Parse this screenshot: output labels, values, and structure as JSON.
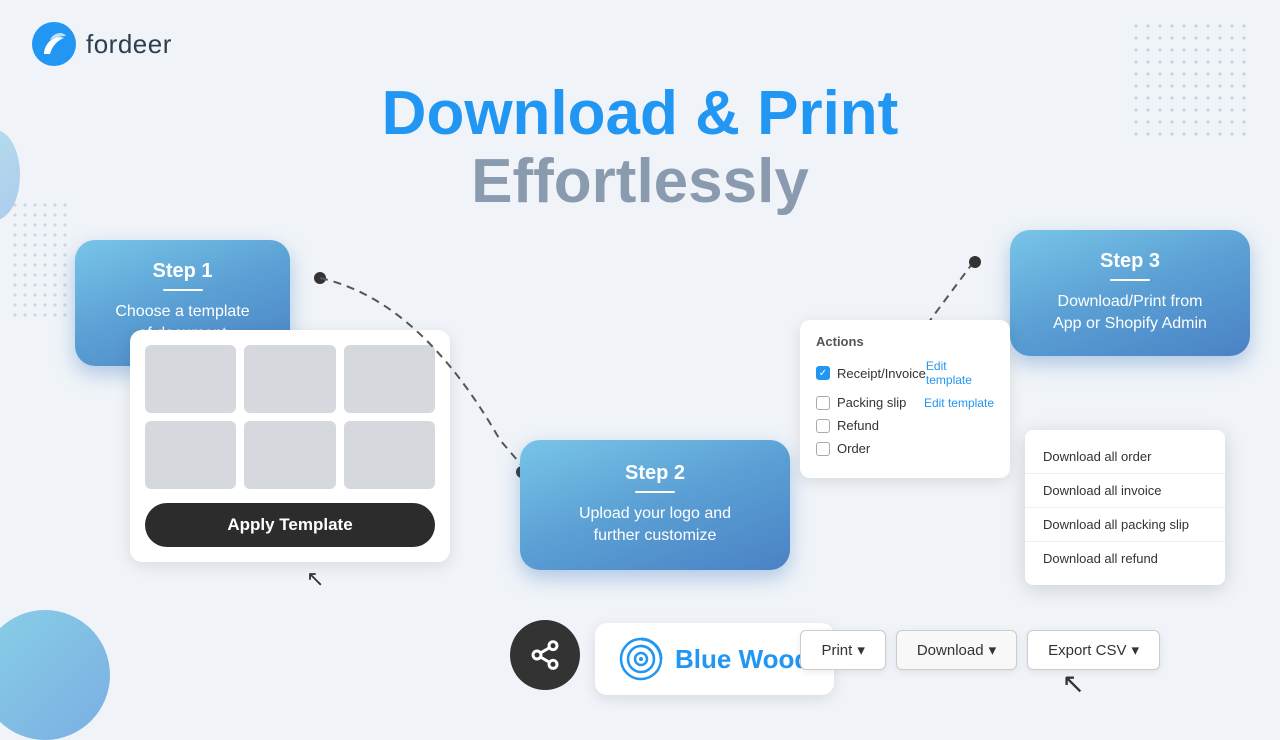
{
  "brand": {
    "logo_alt": "Fordeer logo",
    "name": "fordeer"
  },
  "hero": {
    "line1": "Download & Print",
    "line2": "Effortlessly"
  },
  "step1": {
    "label": "Step 1",
    "description": "Choose a template\nof document",
    "apply_button": "Apply Template"
  },
  "step2": {
    "label": "Step 2",
    "description": "Upload your logo and\nfurther customize"
  },
  "step3": {
    "label": "Step 3",
    "description": "Download/Print from\nApp or Shopify Admin"
  },
  "actions_card": {
    "title": "Actions",
    "items": [
      {
        "name": "Receipt/Invoice",
        "checked": true,
        "edit": "Edit template"
      },
      {
        "name": "Packing slip",
        "checked": false,
        "edit": "Edit template"
      },
      {
        "name": "Refund",
        "checked": false,
        "edit": ""
      },
      {
        "name": "Order",
        "checked": false,
        "edit": ""
      }
    ]
  },
  "download_dropdown": {
    "items": [
      "Download all order",
      "Download all invoice",
      "Download all packing slip",
      "Download all refund"
    ]
  },
  "bottom_buttons": {
    "print": "Print",
    "download": "Download",
    "export_csv": "Export CSV"
  },
  "blue_wood": {
    "name": "Blue Wood"
  }
}
